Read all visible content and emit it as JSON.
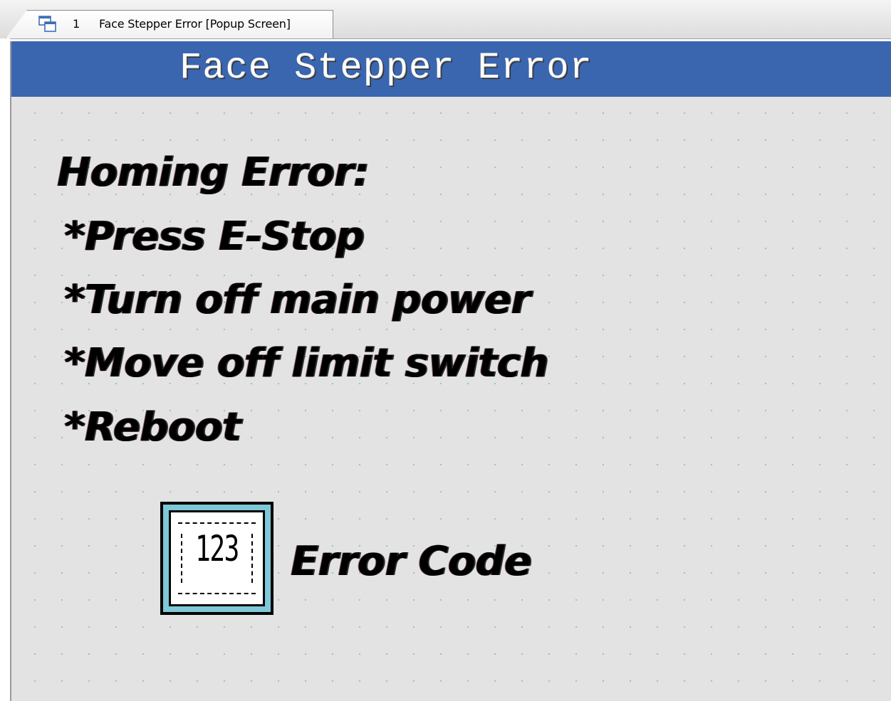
{
  "tab": {
    "number": "1",
    "title": "Face Stepper Error [Popup Screen]",
    "icon": "popup-screen-icon"
  },
  "screen": {
    "title": "Face Stepper Error",
    "title_bar_color": "#3a66b0",
    "background_color": "#e3e3e3",
    "messages": {
      "heading": "Homing Error:",
      "steps": [
        "*Press E-Stop",
        "*Turn off main power",
        "*Move off limit switch",
        "*Reboot"
      ]
    },
    "numeric_display": {
      "placeholder": "123",
      "icon": "numeric-display-icon",
      "label": "Error Code"
    }
  }
}
